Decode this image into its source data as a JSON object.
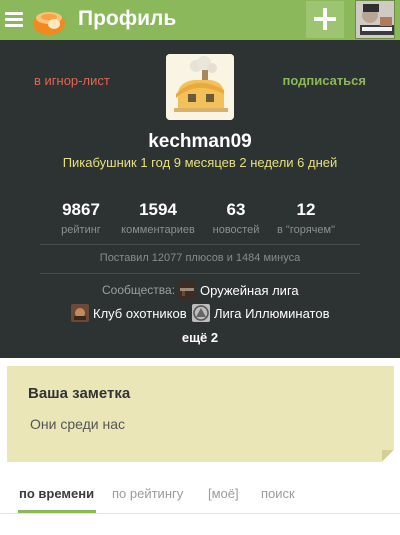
{
  "header": {
    "title": "Профиль",
    "brand_color": "#8ab85a",
    "menu_icon": "hamburger-menu-icon",
    "logo_icon": "pikabu-logo-icon",
    "add_icon": "plus-icon"
  },
  "profile": {
    "ignore_label": "в игнор-лист",
    "subscribe_label": "подписаться",
    "username": "kechman09",
    "membership": "Пикабушник 1 год 9 месяцев 2 недели 6 дней",
    "stats": [
      {
        "value": "9867",
        "label": "рейтинг"
      },
      {
        "value": "1594",
        "label": "комментариев"
      },
      {
        "value": "63",
        "label": "новостей"
      },
      {
        "value": "12",
        "label": "в \"горячем\""
      }
    ],
    "plus_minus": "Поставил 12077 плюсов и 1484 минуса",
    "communities_label": "Сообщества:",
    "communities": [
      {
        "name": "Оружейная лига"
      },
      {
        "name": "Клуб охотников"
      },
      {
        "name": "Лига Иллюминатов"
      }
    ],
    "more_label": "ещё 2"
  },
  "note": {
    "title": "Ваша заметка",
    "text": "Они среди нас"
  },
  "tabs": [
    {
      "label": "по времени",
      "active": true
    },
    {
      "label": "по рейтингу",
      "active": false
    },
    {
      "label": "[моё]",
      "active": false
    },
    {
      "label": "поиск",
      "active": false
    }
  ]
}
